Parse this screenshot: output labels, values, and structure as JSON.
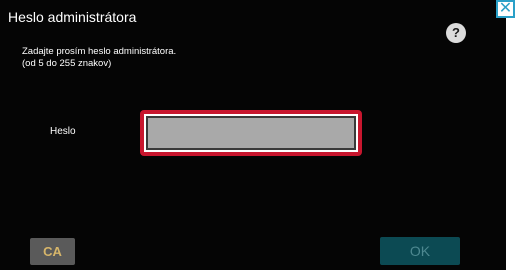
{
  "dialog": {
    "title": "Heslo administrátora",
    "help_label": "?",
    "close_label": "✕",
    "instructions": [
      "Zadajte prosím heslo administrátora.",
      "(od 5 do 255 znakov)"
    ]
  },
  "password_field": {
    "label": "Heslo",
    "value": "",
    "highlight_color": "#c8162e"
  },
  "buttons": {
    "clear_all_label": "CA",
    "ok_label": "OK"
  }
}
